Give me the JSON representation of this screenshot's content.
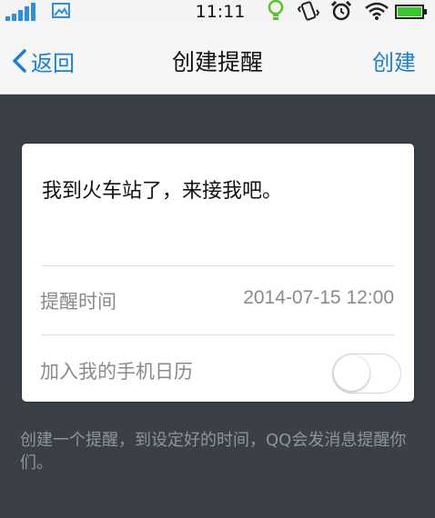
{
  "status_bar": {
    "time": "11:11",
    "icons": [
      "signal-icon",
      "image-icon",
      "bulb-icon",
      "vibrate-icon",
      "alarm-icon",
      "wifi-icon",
      "battery-icon"
    ]
  },
  "nav": {
    "back_label": "返回",
    "title": "创建提醒",
    "create_label": "创建"
  },
  "card": {
    "message": "我到火车站了，来接我吧。",
    "time_label": "提醒时间",
    "time_value": "2014-07-15 12:00",
    "calendar_label": "加入我的手机日历",
    "calendar_toggle_on": false
  },
  "footnote": "创建一个提醒，到设定好的时间，QQ会发消息提醒你们。",
  "colors": {
    "accent": "#1b7fd6",
    "background": "#3a4046",
    "signal": "#2d8fe0",
    "battery": "#35c92c"
  }
}
